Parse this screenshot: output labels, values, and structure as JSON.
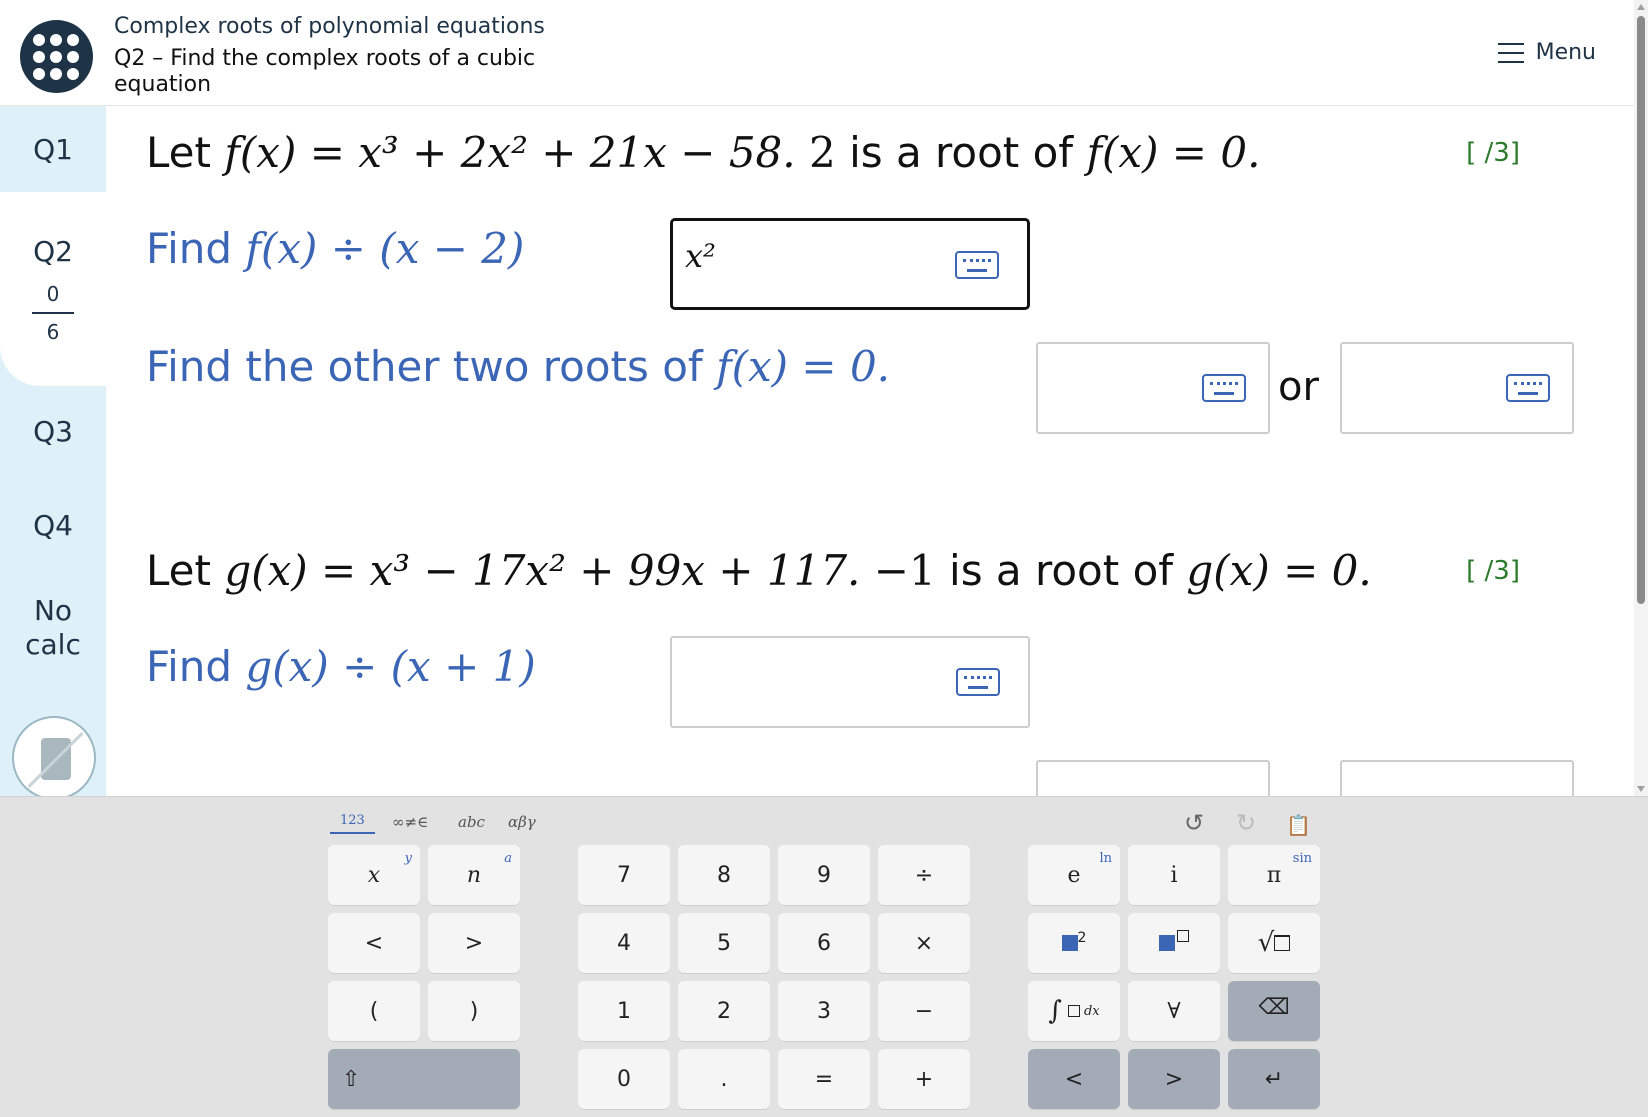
{
  "header": {
    "course_title": "Complex roots of polynomial equations",
    "question_title": "Q2 – Find the complex roots of a cubic equation",
    "menu_label": "Menu"
  },
  "sidebar": {
    "items": [
      {
        "label": "Q1"
      },
      {
        "label": "Q2",
        "score": "0",
        "total": "6"
      },
      {
        "label": "Q3"
      },
      {
        "label": "Q4"
      },
      {
        "label": "No calc"
      }
    ],
    "calculator_icon": "calculator-disabled-icon"
  },
  "parts": [
    {
      "stem": {
        "prefix": "Let ",
        "func": "f(x)",
        "equation_rhs": "= x³ + 2x² + 21x − 58.",
        "root": "2",
        "root_text": " is a root of ",
        "root_eq": "f(x) = 0."
      },
      "marks": "[ /3]",
      "division_prompt": {
        "label": "Find ",
        "expr": "f(x) ÷ (x − 2)"
      },
      "division_answer": "x²",
      "roots_prompt": {
        "label": "Find the other two roots of ",
        "expr": "f(x) = 0."
      },
      "or_label": "or"
    },
    {
      "stem": {
        "prefix": "Let ",
        "func": "g(x)",
        "equation_rhs": "= x³ − 17x² + 99x + 117.",
        "root": "−1",
        "root_text": " is a root of ",
        "root_eq": "g(x) = 0."
      },
      "marks": "[ /3]",
      "division_prompt": {
        "label": "Find ",
        "expr": "g(x) ÷ (x + 1)"
      },
      "division_answer": ""
    }
  ],
  "keyboard": {
    "tabs": [
      "123",
      "∞≠∈",
      "abc",
      "αβγ"
    ],
    "active_tab": "123",
    "tools": [
      "undo-icon",
      "redo-icon",
      "clipboard-icon"
    ],
    "left_keys": [
      {
        "label": "x",
        "alt": "y"
      },
      {
        "label": "n",
        "alt": "a"
      },
      {
        "label": "<"
      },
      {
        "label": ">"
      },
      {
        "label": "("
      },
      {
        "label": ")"
      },
      {
        "label": "⇧"
      }
    ],
    "number_keys": [
      "7",
      "8",
      "9",
      "÷",
      "4",
      "5",
      "6",
      "×",
      "1",
      "2",
      "3",
      "−",
      "0",
      ".",
      "=",
      "+"
    ],
    "right_keys": [
      {
        "label": "e",
        "alt": "ln"
      },
      {
        "label": "i"
      },
      {
        "label": "π",
        "alt": "sin"
      },
      {
        "label": "▢²"
      },
      {
        "label": "▢▢"
      },
      {
        "label": "√▢"
      },
      {
        "label": "∫₀^∞ ▢ dx"
      },
      {
        "label": "∀"
      },
      {
        "label": "⌫"
      },
      {
        "label": "<"
      },
      {
        "label": ">"
      },
      {
        "label": "↵"
      }
    ]
  },
  "colors": {
    "accent": "#3b65b5",
    "header_text": "#1f3347",
    "sidebar_bg": "#dff1f8",
    "marks": "#2c7a2c",
    "keyboard_bg": "#e2e2e2"
  }
}
